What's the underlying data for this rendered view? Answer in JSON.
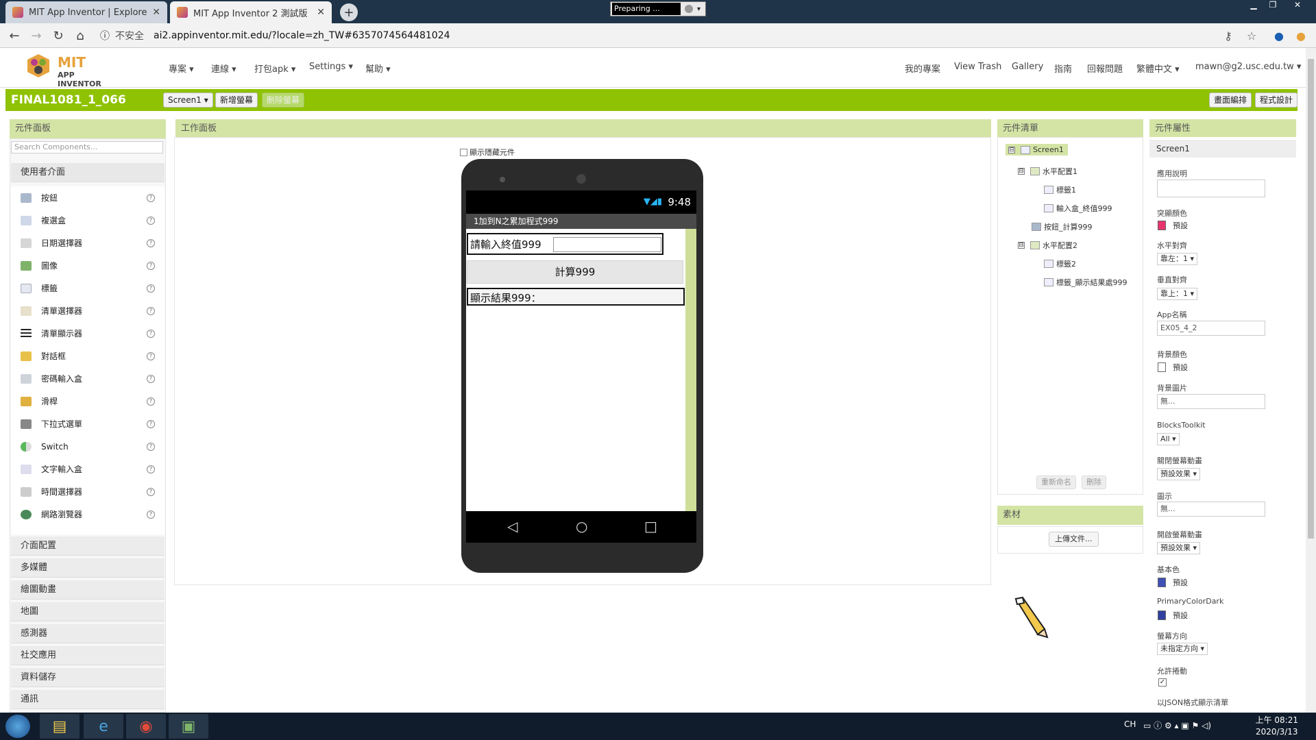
{
  "browser": {
    "tabs": [
      {
        "title": "MIT App Inventor | Explore MIT",
        "close": "✕"
      },
      {
        "title": "MIT App Inventor 2 測試版",
        "close": "✕"
      }
    ],
    "new_tab": "+",
    "recorder_label": "Preparing ...",
    "insecure_label": "不安全",
    "url": "ai2.appinventor.mit.edu/?locale=zh_TW#6357074564481024"
  },
  "app_header": {
    "logo_line1": "MIT",
    "logo_line2": "APP INVENTOR",
    "menus": [
      "專案 ▾",
      "連線 ▾",
      "打包apk ▾",
      "Settings ▾",
      "幫助 ▾"
    ],
    "right_links": [
      "我的專案",
      "View Trash",
      "Gallery",
      "指南",
      "回報問題",
      "繁體中文 ▾",
      "mawn@g2.usc.edu.tw ▾"
    ]
  },
  "toolbar": {
    "project_name": "FINAL1081_1_066",
    "screen_select": "Screen1 ▾",
    "add_screen": "新增螢幕",
    "remove_screen": "刪除螢幕",
    "designer": "畫面編排",
    "blocks": "程式設計"
  },
  "palette": {
    "title": "元件面板",
    "search_placeholder": "Search Components...",
    "user_interface": "使用者介面",
    "items": [
      "按鈕",
      "複選盒",
      "日期選擇器",
      "圖像",
      "標籤",
      "清單選擇器",
      "清單顯示器",
      "對話框",
      "密碼輸入盒",
      "滑桿",
      "下拉式選單",
      "Switch",
      "文字輸入盒",
      "時間選擇器",
      "網路瀏覽器"
    ],
    "help_glyph": "?",
    "categories": [
      "介面配置",
      "多媒體",
      "繪圖動畫",
      "地圖",
      "感測器",
      "社交應用",
      "資料儲存",
      "通訊"
    ]
  },
  "viewer": {
    "title": "工作面板",
    "show_hidden": "顯示隱藏元件",
    "time": "9:48",
    "signal": "▼◢▮",
    "app_title": "1加到N之累加程式999",
    "label1": "請輸入終值999",
    "calc_button": "計算999",
    "result_label": "顯示結果999：",
    "nav_back": "◁",
    "nav_home": "○",
    "nav_recent": "□"
  },
  "tree": {
    "title": "元件清單",
    "nodes": [
      "Screen1",
      "水平配置1",
      "標籤1",
      "輸入盒_終值999",
      "按鈕_計算999",
      "水平配置2",
      "標籤2",
      "標籤_顯示結果處999"
    ],
    "toggle": "⊟",
    "rename": "重新命名",
    "delete": "刪除"
  },
  "media": {
    "title": "素材",
    "upload": "上傳文件..."
  },
  "properties": {
    "title": "元件屬性",
    "component": "Screen1",
    "about_label": "應用說明",
    "accent_label": "突顯顏色",
    "accent_value": "預設",
    "halign_label": "水平對齊",
    "halign_value": "靠左：1 ▾",
    "valign_label": "垂直對齊",
    "valign_value": "靠上：1 ▾",
    "appname_label": "App名稱",
    "appname_value": "EX05_4_2",
    "bgcolor_label": "背景顏色",
    "bgcolor_value": "預設",
    "bgimage_label": "背景圖片",
    "bgimage_value": "無...",
    "blocks_toolkit_label": "BlocksToolkit",
    "blocks_toolkit_value": "All ▾",
    "close_anim_label": "關閉螢幕動畫",
    "close_anim_value": "預設效果 ▾",
    "icon_label": "圖示",
    "icon_value": "無...",
    "open_anim_label": "開啟螢幕動畫",
    "open_anim_value": "預設效果 ▾",
    "primary_label": "基本色",
    "primary_value": "預設",
    "primary_dark_label": "PrimaryColorDark",
    "primary_dark_value": "預設",
    "orientation_label": "螢幕方向",
    "orientation_value": "未指定方向 ▾",
    "scrollable_label": "允許捲動",
    "check_glyph": "✓",
    "json_label": "以JSON格式顯示清單"
  },
  "taskbar": {
    "tray": "CH",
    "time": "上午 08:21",
    "date": "2020/3/13"
  },
  "colors": {
    "green": "#8fc202",
    "panel_header": "#d4e4a5",
    "accent_swatch": "#e8336d",
    "primary_swatch": "#3f51b5",
    "primary_dark_swatch": "#303f9f"
  }
}
